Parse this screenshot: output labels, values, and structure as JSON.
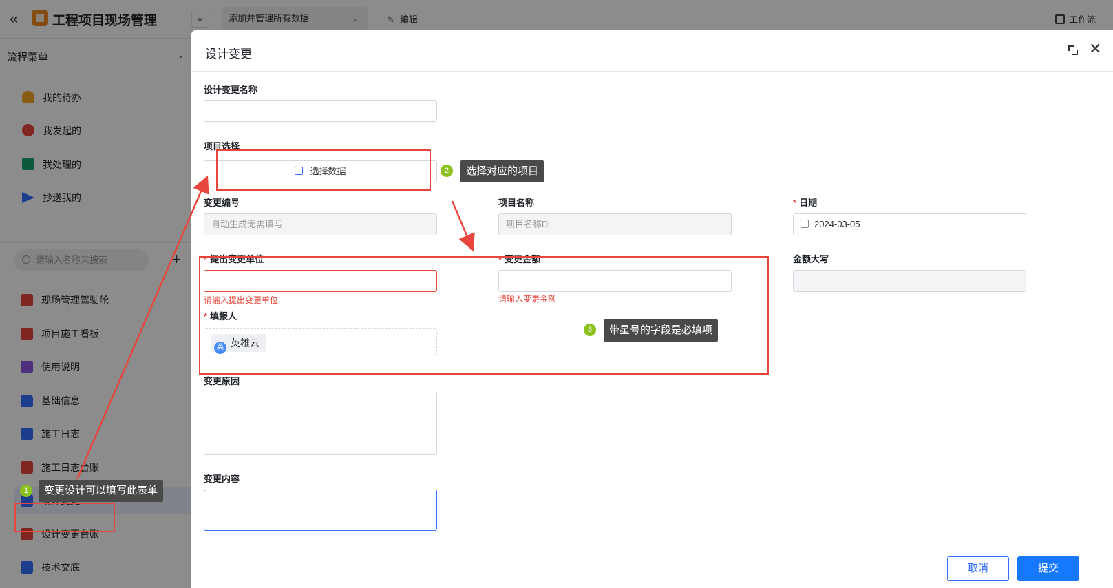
{
  "app": {
    "title": "工程项目现场管理",
    "view_select": "添加并管理所有数据",
    "edit_label": "编辑",
    "workflow_label": "工作流"
  },
  "sidebar": {
    "flow_menu_title": "流程菜单",
    "flow_items": [
      {
        "label": "我的待办",
        "icon": "bell-icon"
      },
      {
        "label": "我发起的",
        "icon": "play-icon"
      },
      {
        "label": "我处理的",
        "icon": "check-icon"
      },
      {
        "label": "抄送我的",
        "icon": "send-icon"
      }
    ],
    "search_placeholder": "请输入名称来搜索",
    "menu_items": [
      {
        "label": "现场管理驾驶舱"
      },
      {
        "label": "项目施工看板"
      },
      {
        "label": "使用说明"
      },
      {
        "label": "基础信息"
      },
      {
        "label": "施工日志"
      },
      {
        "label": "施工日志台账"
      },
      {
        "label": "设计变更"
      },
      {
        "label": "设计变更台账"
      },
      {
        "label": "技术交底"
      }
    ]
  },
  "modal": {
    "title": "设计变更",
    "fields": {
      "name": {
        "label": "设计变更名称",
        "value": ""
      },
      "project_select": {
        "label": "项目选择",
        "button": "选择数据"
      },
      "change_no": {
        "label": "变更编号",
        "placeholder": "自动生成无需填写"
      },
      "project_name": {
        "label": "项目名称",
        "placeholder": "项目名称D"
      },
      "date": {
        "label": "日期",
        "required_mark": "*",
        "value": "2024-03-05"
      },
      "unit": {
        "label": "提出变更单位",
        "required_mark": "*",
        "error": "请输入提出变更单位"
      },
      "amount": {
        "label": "变更金额",
        "required_mark": "*",
        "error": "请输入变更金额"
      },
      "amount_upper": {
        "label": "金额大写"
      },
      "reporter": {
        "label": "填报人",
        "required_mark": "*",
        "user_name": "英雄云",
        "avatar_text": "英"
      },
      "reason": {
        "label": "变更原因"
      },
      "content": {
        "label": "变更内容"
      }
    },
    "footer": {
      "cancel": "取消",
      "submit": "提交"
    }
  },
  "annotations": [
    {
      "badge": "1",
      "text": "变更设计可以填写此表单"
    },
    {
      "badge": "2",
      "text": "选择对应的项目"
    },
    {
      "badge": "3",
      "text": "带星号的字段是必填项"
    }
  ],
  "colors": {
    "primary": "#1677ff",
    "error": "#e8453c",
    "annotation_red": "#e8453c",
    "badge_green": "#8cc21d"
  }
}
